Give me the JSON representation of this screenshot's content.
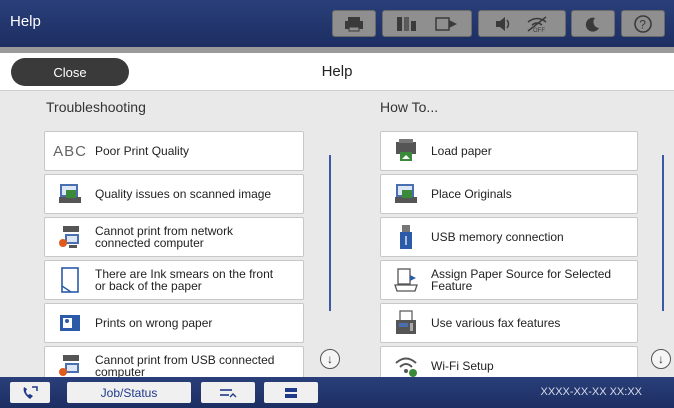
{
  "topbar": {
    "title": "Help",
    "icons": [
      "printer-icon",
      "ink-icon",
      "paper-icon",
      "volume-icon",
      "wifi-off-icon",
      "sleep-icon",
      "help-icon"
    ]
  },
  "header": {
    "close_label": "Close",
    "title": "Help"
  },
  "troubleshooting": {
    "title": "Troubleshooting",
    "items": [
      {
        "label": "Poor Print Quality",
        "icon": "abc-text-icon"
      },
      {
        "label": "Quality issues on scanned image",
        "icon": "scanner-icon"
      },
      {
        "label_line1": "Cannot print from network",
        "label_line2": "connected computer",
        "icon": "network-computer-error-icon"
      },
      {
        "label_line1": "There are Ink smears on the front",
        "label_line2": "or back of the paper",
        "icon": "paper-smear-icon"
      },
      {
        "label": "Prints on wrong paper",
        "icon": "wrong-paper-icon"
      },
      {
        "label_line1": "Cannot print from USB connected",
        "label_line2": "computer",
        "icon": "usb-computer-error-icon"
      }
    ]
  },
  "howto": {
    "title": "How To...",
    "items": [
      {
        "label": "Load paper",
        "icon": "load-paper-icon"
      },
      {
        "label": "Place Originals",
        "icon": "place-originals-icon"
      },
      {
        "label": "USB memory connection",
        "icon": "usb-memory-icon"
      },
      {
        "label_line1": "Assign Paper Source for Selected",
        "label_line2": "Feature",
        "icon": "paper-source-icon"
      },
      {
        "label": "Use various fax features",
        "icon": "fax-icon"
      },
      {
        "label": "Wi-Fi Setup",
        "icon": "wifi-setup-icon"
      }
    ]
  },
  "bottombar": {
    "job_status_label": "Job/Status",
    "datetime": "XXXX-XX-XX XX:XX"
  }
}
